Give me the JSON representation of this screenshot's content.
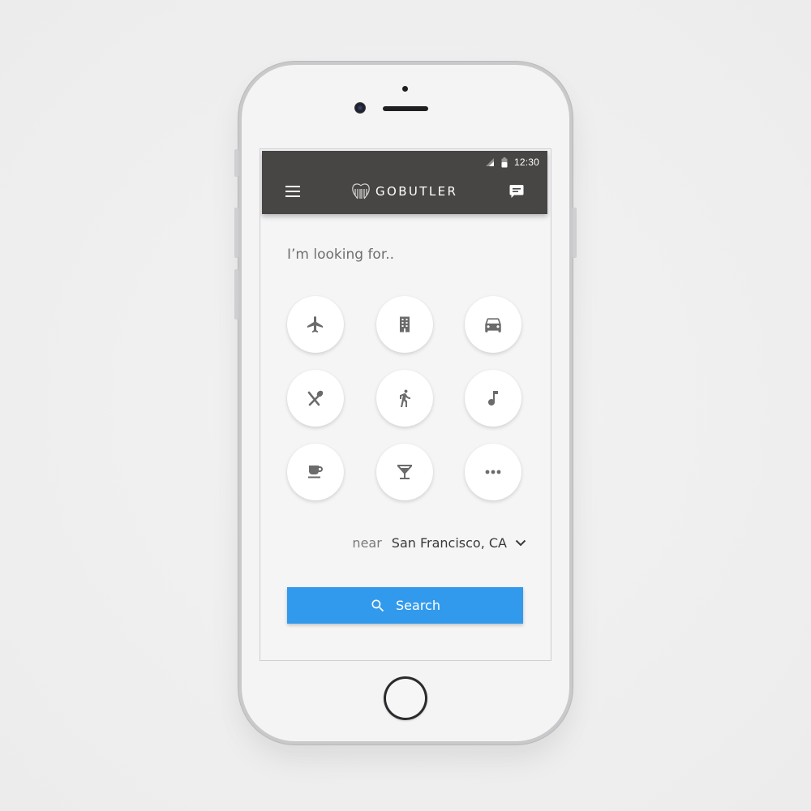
{
  "status_bar": {
    "time": "12:30",
    "icons": [
      "signal-icon",
      "battery-icon"
    ]
  },
  "app_bar": {
    "brand": "GOBUTLER",
    "icons": [
      "menu-icon",
      "gobutler-logo",
      "chat-icon"
    ]
  },
  "main": {
    "prompt": "I’m looking for..",
    "categories": [
      {
        "icon": "flight-icon"
      },
      {
        "icon": "hotel-icon"
      },
      {
        "icon": "car-icon"
      },
      {
        "icon": "restaurant-icon"
      },
      {
        "icon": "walking-icon"
      },
      {
        "icon": "music-icon"
      },
      {
        "icon": "coffee-icon"
      },
      {
        "icon": "bar-icon"
      },
      {
        "icon": "more-icon"
      }
    ],
    "near_label": "near",
    "location": "San Francisco, CA",
    "search_label": "Search"
  },
  "colors": {
    "app_bar": "#474645",
    "accent": "#329aec",
    "icon_gray": "#6b6b6b",
    "screen_bg": "#f5f5f6"
  }
}
